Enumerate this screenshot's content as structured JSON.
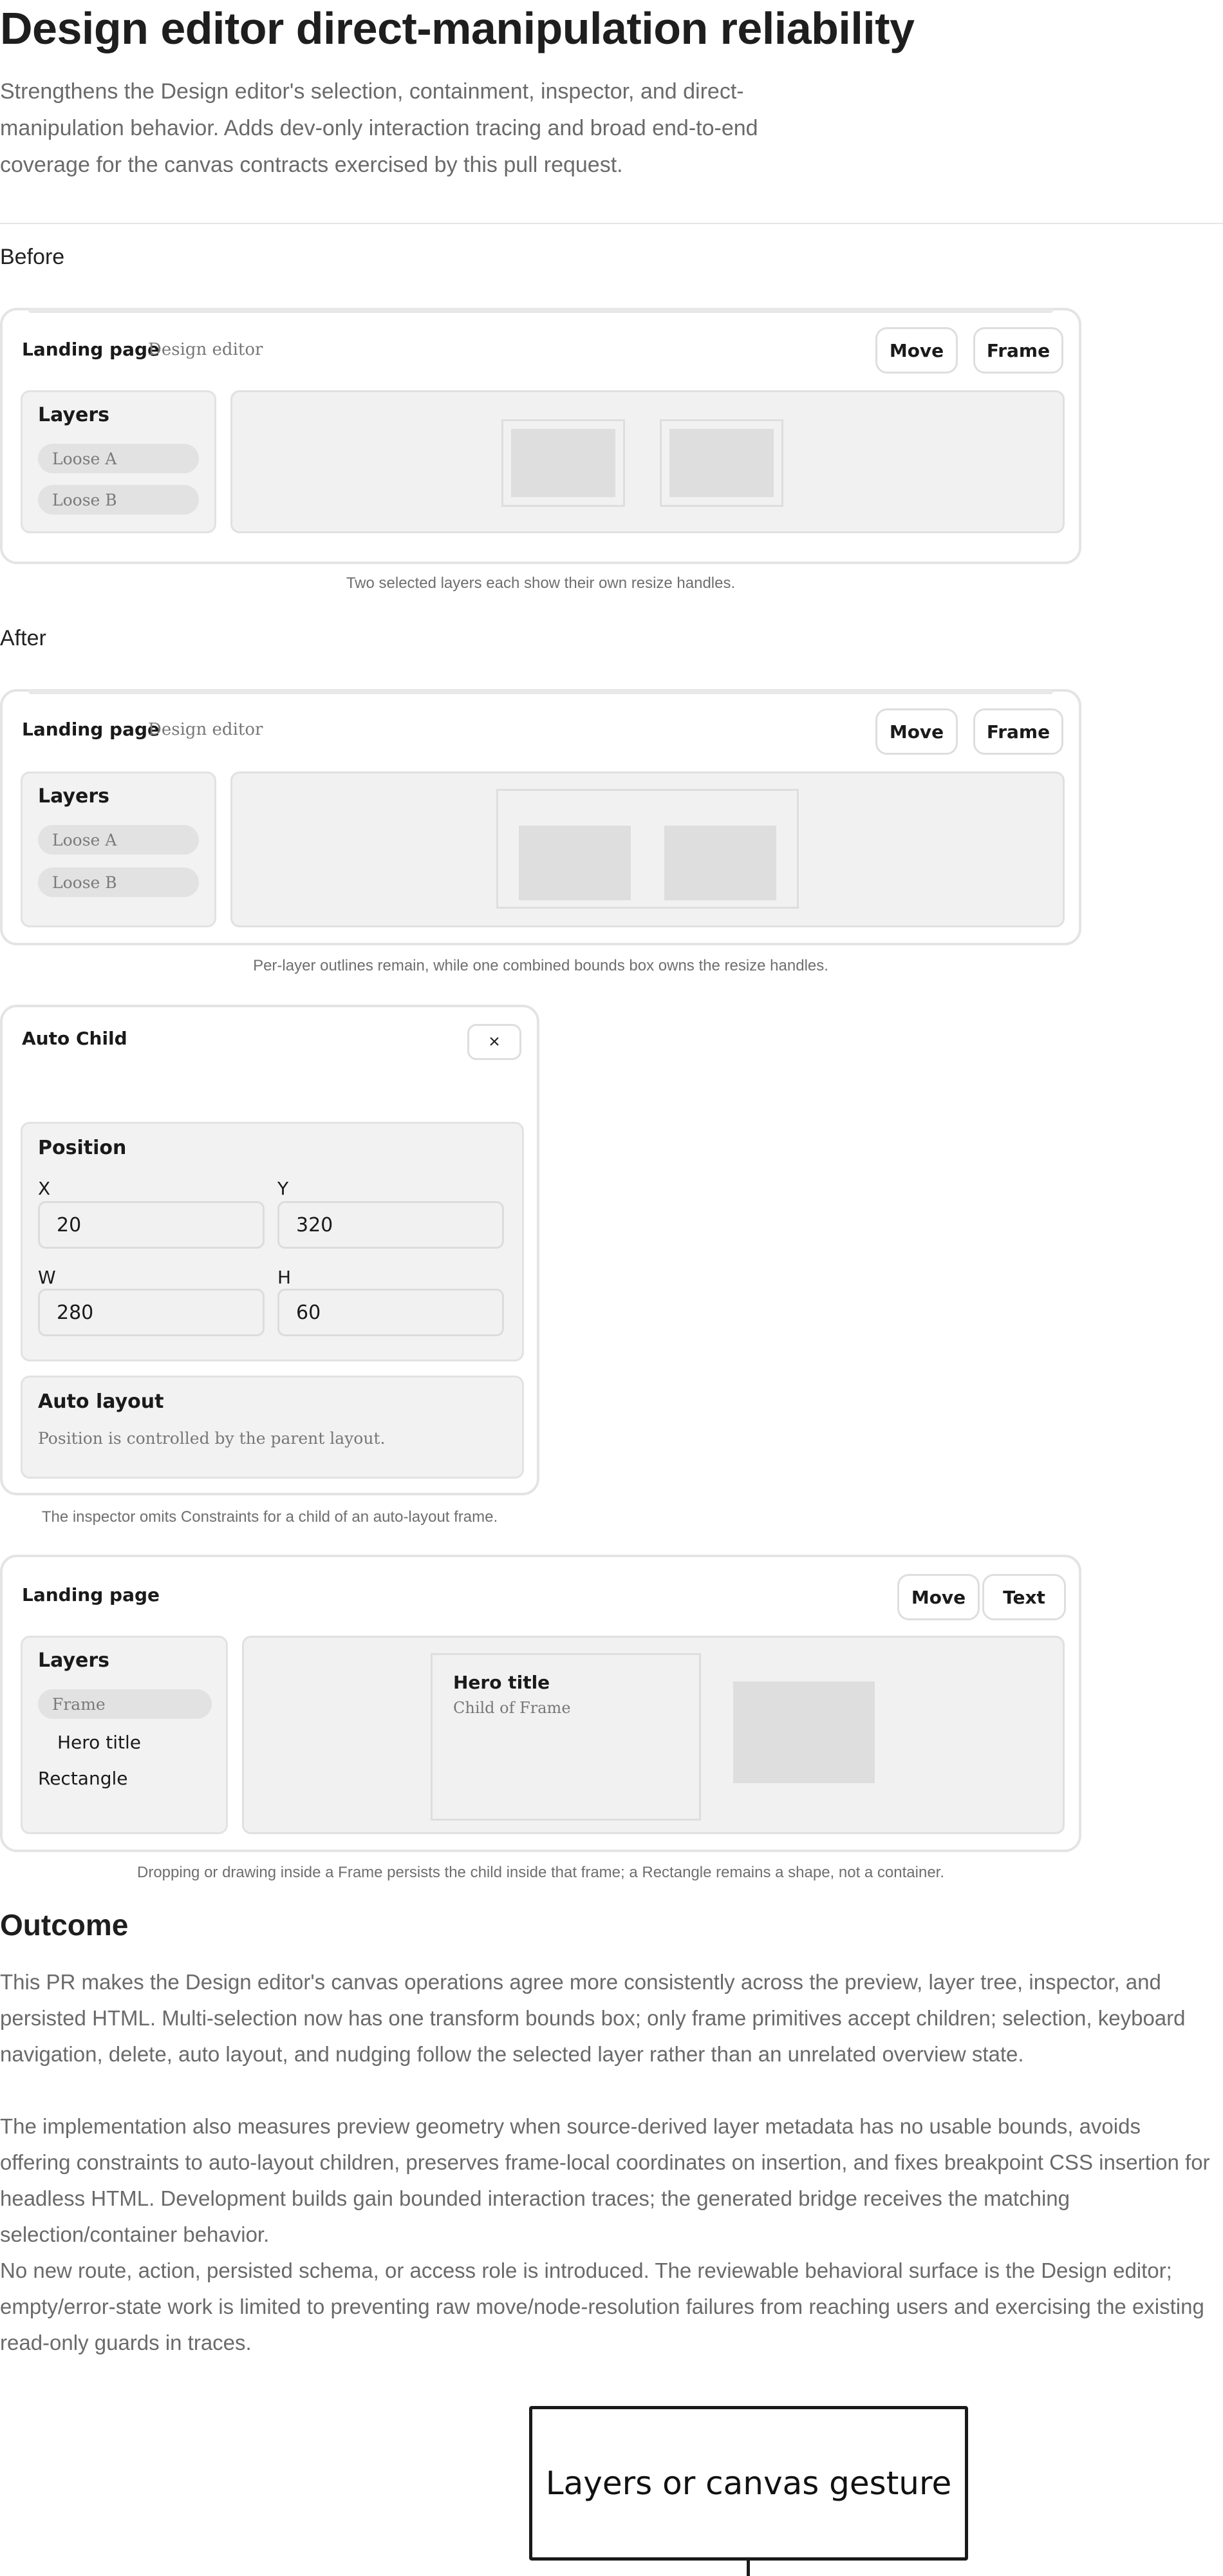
{
  "title": "Design editor direct-manipulation reliability",
  "intro": "Strengthens the Design editor's selection, containment, inspector, and direct-manipulation behavior. Adds dev-only interaction tracing and broad end-to-end coverage for the canvas contracts exercised by this pull request.",
  "before": {
    "label": "Before",
    "app_title": "Landing page",
    "app_sub": "Design editor",
    "buttons": [
      "Move",
      "Frame"
    ],
    "layers_title": "Layers",
    "layers": [
      "Loose A",
      "Loose B"
    ],
    "caption": "Two selected layers each show their own resize handles."
  },
  "after": {
    "label": "After",
    "app_title": "Landing page",
    "app_sub": "Design editor",
    "buttons": [
      "Move",
      "Frame"
    ],
    "layers_title": "Layers",
    "layers": [
      "Loose A",
      "Loose B"
    ],
    "caption": "Per-layer outlines remain, while one combined bounds box owns the resize handles."
  },
  "inspector": {
    "title": "Auto Child",
    "close": "×",
    "position_title": "Position",
    "fields": [
      {
        "label": "X",
        "value": "20"
      },
      {
        "label": "Y",
        "value": "320"
      },
      {
        "label": "W",
        "value": "280"
      },
      {
        "label": "H",
        "value": "60"
      }
    ],
    "auto_title": "Auto layout",
    "auto_text": "Position is controlled by the parent layout.",
    "caption": "The inspector omits Constraints for a child of an auto-layout frame."
  },
  "containment": {
    "app_title": "Landing page",
    "buttons": [
      "Move",
      "Text"
    ],
    "layers_title": "Layers",
    "layers": [
      "Frame",
      "Hero title",
      "Rectangle"
    ],
    "hero_title": "Hero title",
    "hero_sub": "Child of Frame",
    "caption": "Dropping or drawing inside a Frame persists the child inside that frame; a Rectangle remains a shape, not a container."
  },
  "outcome": {
    "title": "Outcome",
    "paragraphs": [
      "This PR makes the Design editor's canvas operations agree more consistently across the preview, layer tree, inspector, and persisted HTML. Multi-selection now has one transform bounds box; only frame primitives accept children; selection, keyboard navigation, delete, auto layout, and nudging follow the selected layer rather than an unrelated overview state.",
      "The implementation also measures preview geometry when source-derived layer metadata has no usable bounds, avoids offering constraints to auto-layout children, preserves frame-local coordinates on insertion, and fixes breakpoint CSS insertion for headless HTML. Development builds gain bounded interaction traces; the generated bridge receives the matching selection/container behavior.",
      "No new route, action, persisted schema, or access role is introduced. The reviewable behavioral surface is the Design editor; empty/error-state work is limited to preventing raw move/node-resolution failures from reaching users and exercising the existing read-only guards in traces."
    ]
  },
  "flow": {
    "first_node": "Layers or canvas gesture"
  }
}
